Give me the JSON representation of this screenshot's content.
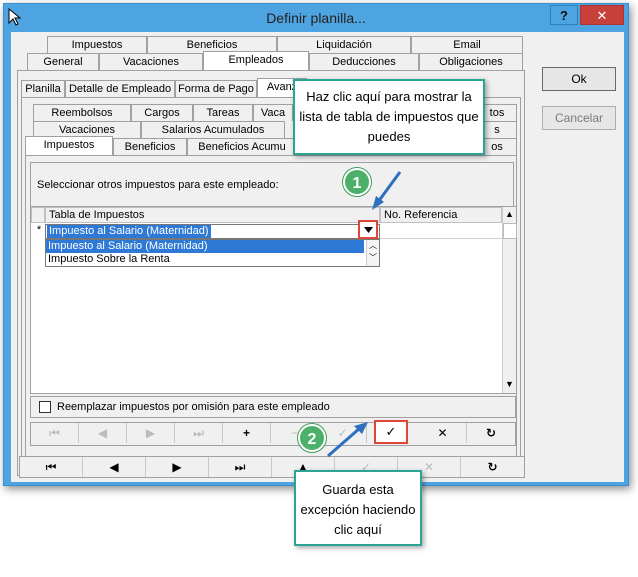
{
  "window": {
    "title": "Definir planilla...",
    "help_label": "?",
    "close_label": "✕"
  },
  "tabs_row1": [
    "Impuestos",
    "Beneficios",
    "Liquidación",
    "Email"
  ],
  "tabs_row2": [
    "General",
    "Vacaciones",
    "Empleados",
    "Deducciones",
    "Obligaciones"
  ],
  "tabs_row3": [
    "Planilla",
    "Detalle de Empleado",
    "Forma de Pago",
    "Avanz"
  ],
  "tabs_row4": [
    "Reembolsos",
    "Cargos",
    "Tareas",
    "Vaca",
    "tos"
  ],
  "tabs_row5": [
    "Vacaciones",
    "Salarios Acumulados",
    "s"
  ],
  "tabs_row6": [
    "Impuestos",
    "Beneficios",
    "Beneficios Acumu",
    "os"
  ],
  "side_buttons": {
    "ok": "Ok",
    "cancel": "Cancelar"
  },
  "panel": {
    "instruction": "Seleccionar otros impuestos para este empleado:",
    "col_tax_table": "Tabla de Impuestos",
    "col_reference": "No. Referencia",
    "row_marker": "*",
    "current_value": "Impuesto al Salario  (Maternidad)",
    "dropdown_options": [
      "Impuesto al Salario  (Maternidad)",
      "Impuesto Sobre la Renta"
    ],
    "replace_checkbox_label": "Reemplazar impuestos por omisión para este empleado"
  },
  "inner_nav": [
    "⏮",
    "◀",
    "▶",
    "⏭",
    "+",
    "−",
    "✓",
    "✓",
    "✕",
    "↻"
  ],
  "outer_nav": [
    "⏮",
    "◀",
    "▶",
    "⏭",
    "▲",
    "✓",
    "✕",
    "↻"
  ],
  "callouts": {
    "one": "Haz clic aquí para mostrar la lista de tabla de impuestos que puedes",
    "two": "Guarda esta excepción haciendo clic aquí"
  },
  "badges": {
    "one": "1",
    "two": "2"
  },
  "colors": {
    "accent": "#2aa593",
    "highlight": "#e0453a",
    "badge": "#4caf6a",
    "selection": "#2f79d6"
  }
}
